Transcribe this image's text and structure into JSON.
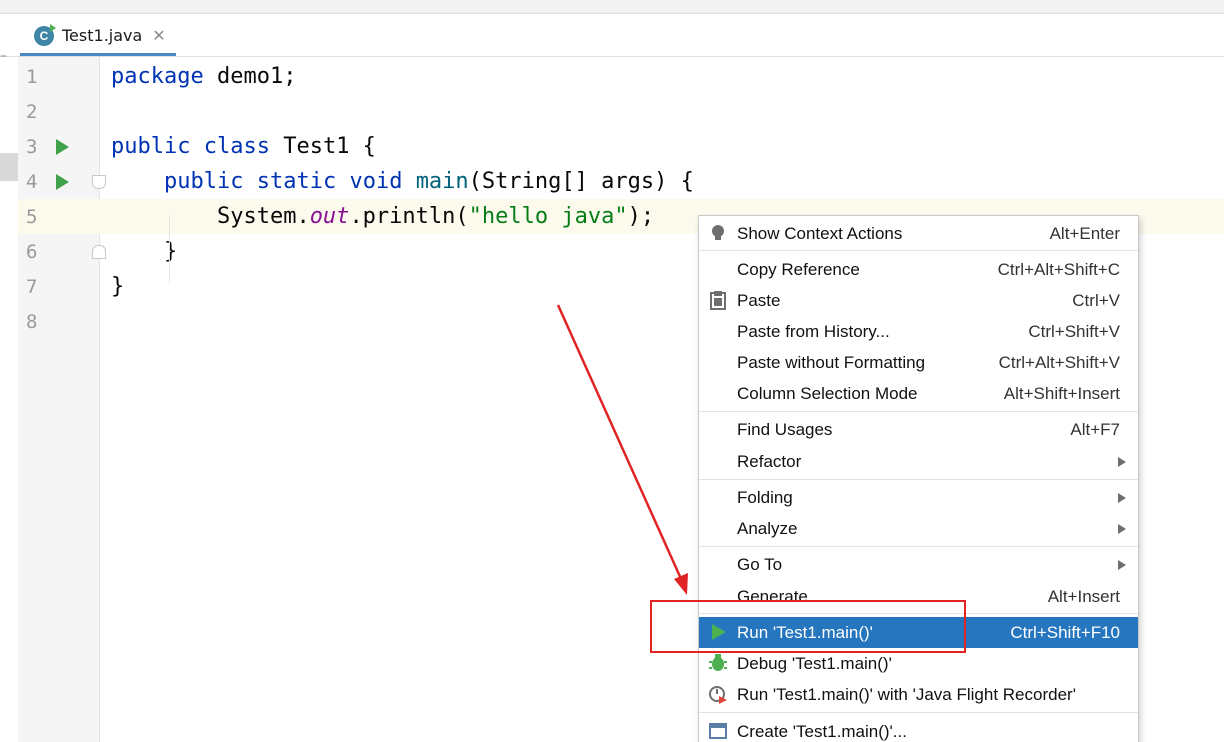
{
  "tabs": [
    {
      "label": "Test1.java",
      "icon": "java-class-icon",
      "close": "✕"
    }
  ],
  "gutter": {
    "line_numbers": [
      "1",
      "2",
      "3",
      "4",
      "5",
      "6",
      "7",
      "8"
    ]
  },
  "code": {
    "line1": {
      "kw": "package",
      "rest": " demo1;"
    },
    "line3": {
      "kw1": "public",
      "kw2": "class",
      "rest": " Test1 {"
    },
    "line4": {
      "indent": "    ",
      "kw1": "public",
      "kw2": "static",
      "kw3": "void",
      "name": "main",
      "rest": "(String[] args) {"
    },
    "line5": {
      "indent": "        ",
      "pre": "System.",
      "field": "out",
      "mid": ".println(",
      "str": "\"hello java\"",
      "post": ");"
    },
    "line6": {
      "text": "    }"
    },
    "line7": {
      "text": "}"
    }
  },
  "context_menu": {
    "items": [
      {
        "label": "Show Context Actions",
        "shortcut": "Alt+Enter",
        "icon": "lightbulb-icon"
      },
      {
        "label": "Copy Reference",
        "shortcut": "Ctrl+Alt+Shift+C"
      },
      {
        "label": "Paste",
        "shortcut": "Ctrl+V",
        "icon": "clipboard-icon"
      },
      {
        "label": "Paste from History...",
        "shortcut": "Ctrl+Shift+V"
      },
      {
        "label": "Paste without Formatting",
        "shortcut": "Ctrl+Alt+Shift+V"
      },
      {
        "label": "Column Selection Mode",
        "shortcut": "Alt+Shift+Insert"
      },
      {
        "label": "Find Usages",
        "shortcut": "Alt+F7"
      },
      {
        "label": "Refactor",
        "submenu": true
      },
      {
        "label": "Folding",
        "submenu": true
      },
      {
        "label": "Analyze",
        "submenu": true
      },
      {
        "label": "Go To",
        "submenu": true
      },
      {
        "label": "Generate...",
        "shortcut": "Alt+Insert"
      },
      {
        "label": "Run 'Test1.main()'",
        "shortcut": "Ctrl+Shift+F10",
        "icon": "run-icon",
        "selected": true
      },
      {
        "label": "Debug 'Test1.main()'",
        "icon": "debug-bug-icon"
      },
      {
        "label": "Run 'Test1.main()' with 'Java Flight Recorder'",
        "icon": "profiler-icon"
      },
      {
        "label": "Create 'Test1.main()'...",
        "icon": "run-config-icon"
      }
    ]
  },
  "colors": {
    "keyword": "#0033b3",
    "field": "#871094",
    "string": "#067d17",
    "selection": "#2675bf",
    "annotation": "#e02424",
    "run_green": "#3fa14a"
  }
}
